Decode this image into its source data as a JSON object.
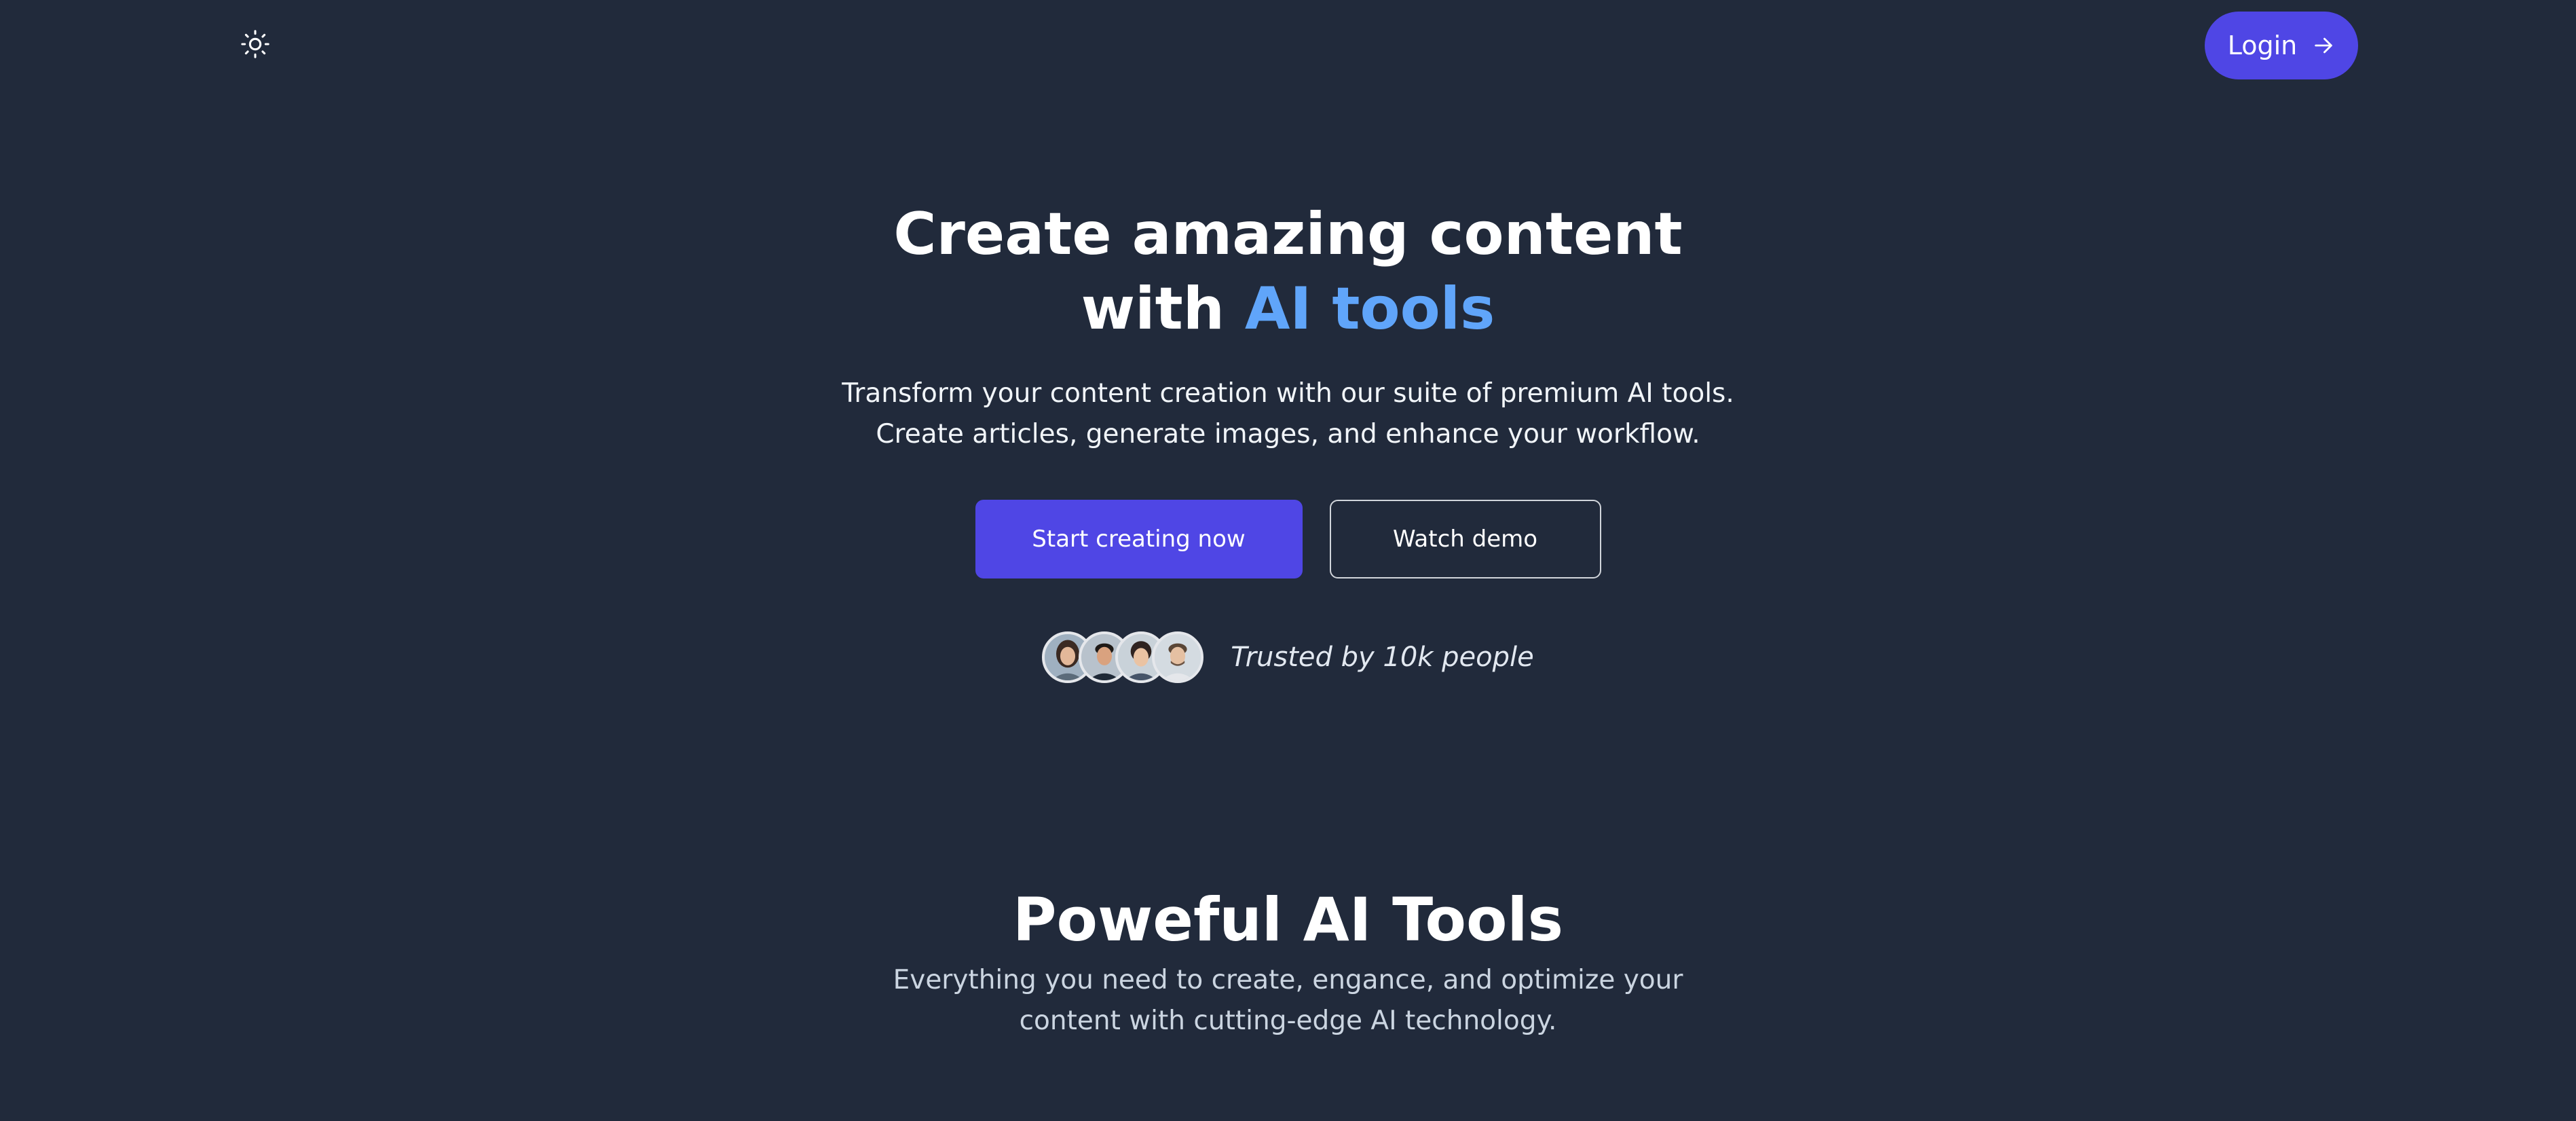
{
  "header": {
    "theme_icon": "sun-icon",
    "login_label": "Login",
    "login_icon": "arrow-right-icon"
  },
  "hero": {
    "title_line1": "Create amazing content",
    "title_line2_prefix": "with ",
    "title_line2_accent": "AI tools",
    "subtitle": "Transform your content creation with our suite of premium AI tools. Create articles, generate images, and enhance your workflow.",
    "primary_cta": "Start creating now",
    "secondary_cta": "Watch demo",
    "trust_text": "Trusted by 10k people"
  },
  "tools": {
    "title": "Poweful AI Tools",
    "subtitle": "Everything you need to create, engance, and optimize your content with cutting-edge AI technology."
  },
  "colors": {
    "background": "#212a3b",
    "primary": "#4f46e5",
    "accent": "#60a5fa"
  }
}
